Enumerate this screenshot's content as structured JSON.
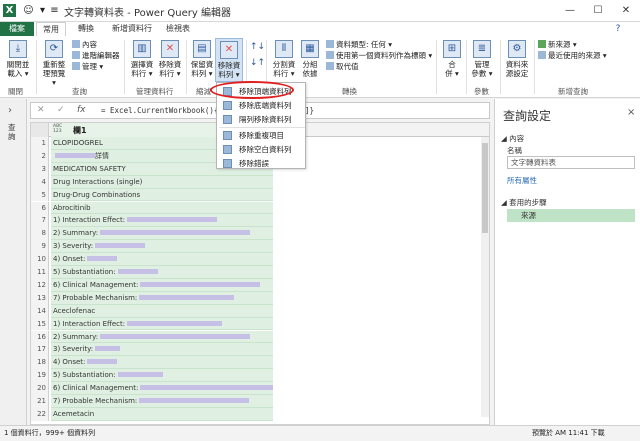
{
  "window": {
    "title": "文字轉資料表 - Power Query 編輯器",
    "app_icon": "X",
    "minimize": "—",
    "maximize": "☐",
    "close": "✕",
    "help": "?"
  },
  "tabs": [
    "檔案",
    "常用",
    "轉換",
    "新增資料行",
    "檢視表"
  ],
  "ribbon": {
    "close_load": "關閉並\n載入 ▾",
    "refresh": "重新整\n理預覽 ▾",
    "properties": "內容",
    "advanced_editor": "進階編輯器",
    "manage": "管理 ▾",
    "choose_columns": "選擇資\n料行 ▾",
    "remove_columns": "移除資\n料行 ▾",
    "keep_rows": "保留資\n料列 ▾",
    "remove_rows": "移除資\n料列 ▾",
    "split_column": "分割資\n料行 ▾",
    "group_by": "分組\n依據",
    "data_type": "資料類型: 任何 ▾",
    "first_row_header": "使用第一個資料列作為標頭 ▾",
    "replace_values": "取代值",
    "merge": "合\n併 ▾",
    "manage_params": "管理\n參數 ▾",
    "data_source_settings": "資料來\n源設定",
    "new_source": "新來源 ▾",
    "recent_sources": "最近使用的來源 ▾",
    "groups": {
      "close": "關閉",
      "query": "查詢",
      "manage_columns": "管理資料行",
      "reduce_rows": "縮減",
      "transform": "轉換",
      "parameters": "參數",
      "data_sources": "資料來源",
      "new_query": "新增查詢"
    }
  },
  "leftnav": {
    "label": "查詢",
    "arrow": "›"
  },
  "formula": {
    "cancel": "✕",
    "confirm": "✓",
    "fx": "fx",
    "text": "= Excel.CurrentWorkbook(){[",
    "text_tail": "]}"
  },
  "grid": {
    "type_icon": "ABC\n123",
    "column_header": "欄1",
    "rows": [
      {
        "n": "1",
        "text": "CLOPIDOGREL",
        "blur": 0
      },
      {
        "n": "2",
        "text": "",
        "blur": 40,
        "suffix": "詳情"
      },
      {
        "n": "3",
        "text": "MEDICATION SAFETY",
        "blur": 0
      },
      {
        "n": "4",
        "text": "Drug Interactions (single)",
        "blur": 0
      },
      {
        "n": "5",
        "text": "Drug-Drug Combinations",
        "blur": 0
      },
      {
        "n": "6",
        "text": "Abrocitinib",
        "blur": 0
      },
      {
        "n": "7",
        "text": "1) Interaction Effect:",
        "blur": 90
      },
      {
        "n": "8",
        "text": "2) Summary:",
        "blur": 150
      },
      {
        "n": "9",
        "text": "3) Severity:",
        "blur": 50
      },
      {
        "n": "10",
        "text": "4) Onset:",
        "blur": 30
      },
      {
        "n": "11",
        "text": "5) Substantiation:",
        "blur": 40
      },
      {
        "n": "12",
        "text": "6) Clinical Management:",
        "blur": 120
      },
      {
        "n": "13",
        "text": "7) Probable Mechanism:",
        "blur": 95
      },
      {
        "n": "14",
        "text": "Aceclofenac",
        "blur": 0
      },
      {
        "n": "15",
        "text": "1) Interaction Effect:",
        "blur": 95
      },
      {
        "n": "16",
        "text": "2) Summary:",
        "blur": 150
      },
      {
        "n": "17",
        "text": "3) Severity:",
        "blur": 25
      },
      {
        "n": "18",
        "text": "4) Onset:",
        "blur": 30
      },
      {
        "n": "19",
        "text": "5) Substantiation:",
        "blur": 45
      },
      {
        "n": "20",
        "text": "6) Clinical Management:",
        "blur": 140
      },
      {
        "n": "21",
        "text": "7) Probable Mechanism:",
        "blur": 110
      },
      {
        "n": "22",
        "text": "Acemetacin",
        "blur": 0
      }
    ]
  },
  "menu": {
    "items": [
      "移除頂端資料列",
      "移除底端資料列",
      "隔列移除資料列",
      "移除重複項目",
      "移除空白資料列",
      "移除錯誤"
    ]
  },
  "query_settings": {
    "title": "查詢設定",
    "collapse": "<",
    "close": "×",
    "properties_section": "◢ 內容",
    "name_label": "名稱",
    "name_value": "文字轉資料表",
    "all_properties": "所有屬性",
    "applied_steps_section": "◢ 套用的步驟",
    "steps": [
      "來源"
    ]
  },
  "status": {
    "left": "1 個資料行，999+ 個資料列",
    "right": "預覽於 AM 11:41 下載"
  },
  "colors": {
    "accent": "#217346",
    "highlight_ring": "#e02020",
    "cell_bg": "#dff0e2",
    "step_bg": "#bfe3c6"
  }
}
